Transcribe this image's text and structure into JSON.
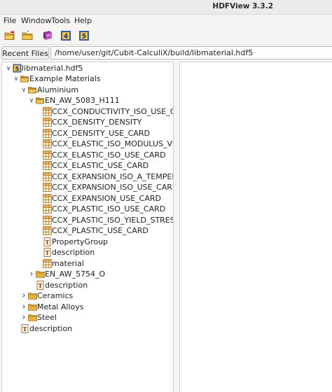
{
  "window": {
    "title": "HDFView 3.3.2"
  },
  "menu": {
    "items": [
      {
        "label": "File"
      },
      {
        "label": "Window"
      },
      {
        "label": "Tools"
      },
      {
        "label": "Help"
      }
    ]
  },
  "toolbar": {
    "buttons": [
      {
        "icon": "open-file-icon"
      },
      {
        "icon": "open-folder-icon"
      },
      {
        "icon": "library-book-icon"
      },
      {
        "icon": "hdf4-icon"
      },
      {
        "icon": "hdf5-icon"
      }
    ]
  },
  "recent": {
    "button_label": "Recent Files",
    "path": "/home/user/git/Cubit-CalculiX/build/libmaterial.hdf5"
  },
  "tree": {
    "nodes": [
      {
        "label": "libmaterial.hdf5",
        "icon": "hdf5-file-icon",
        "toggle": "expanded"
      },
      {
        "label": "Example Materials",
        "icon": "folder-open-icon",
        "toggle": "expanded"
      },
      {
        "label": "Aluminium",
        "icon": "folder-open-icon",
        "toggle": "expanded"
      },
      {
        "label": "EN_AW_5083_H111",
        "icon": "folder-open-icon",
        "toggle": "expanded"
      },
      {
        "label": "CCX_CONDUCTIVITY_ISO_USE_CA",
        "icon": "dataset-icon",
        "toggle": ""
      },
      {
        "label": "CCX_DENSITY_DENSITY",
        "icon": "dataset-icon",
        "toggle": ""
      },
      {
        "label": "CCX_DENSITY_USE_CARD",
        "icon": "dataset-icon",
        "toggle": ""
      },
      {
        "label": "CCX_ELASTIC_ISO_MODULUS_VS",
        "icon": "dataset-icon",
        "toggle": ""
      },
      {
        "label": "CCX_ELASTIC_ISO_USE_CARD",
        "icon": "dataset-icon",
        "toggle": ""
      },
      {
        "label": "CCX_ELASTIC_USE_CARD",
        "icon": "dataset-icon",
        "toggle": ""
      },
      {
        "label": "CCX_EXPANSION_ISO_A_TEMPER",
        "icon": "dataset-icon",
        "toggle": ""
      },
      {
        "label": "CCX_EXPANSION_ISO_USE_CARD",
        "icon": "dataset-icon",
        "toggle": ""
      },
      {
        "label": "CCX_EXPANSION_USE_CARD",
        "icon": "dataset-icon",
        "toggle": ""
      },
      {
        "label": "CCX_PLASTIC_ISO_USE_CARD",
        "icon": "dataset-icon",
        "toggle": ""
      },
      {
        "label": "CCX_PLASTIC_ISO_YIELD_STRESS",
        "icon": "dataset-icon",
        "toggle": ""
      },
      {
        "label": "CCX_PLASTIC_USE_CARD",
        "icon": "dataset-icon",
        "toggle": ""
      },
      {
        "label": "PropertyGroup",
        "icon": "text-dataset-icon",
        "toggle": ""
      },
      {
        "label": "description",
        "icon": "text-dataset-icon",
        "toggle": ""
      },
      {
        "label": "material",
        "icon": "dataset-icon",
        "toggle": ""
      },
      {
        "label": "EN_AW_5754_O",
        "icon": "folder-icon",
        "toggle": "collapsed"
      },
      {
        "label": "description",
        "icon": "text-dataset-icon",
        "toggle": ""
      },
      {
        "label": "Ceramics",
        "icon": "folder-icon",
        "toggle": "collapsed"
      },
      {
        "label": "Metal Alloys",
        "icon": "folder-icon",
        "toggle": "collapsed"
      },
      {
        "label": "Steel",
        "icon": "folder-icon",
        "toggle": "collapsed"
      },
      {
        "label": "description",
        "icon": "text-dataset-icon",
        "toggle": ""
      }
    ]
  }
}
